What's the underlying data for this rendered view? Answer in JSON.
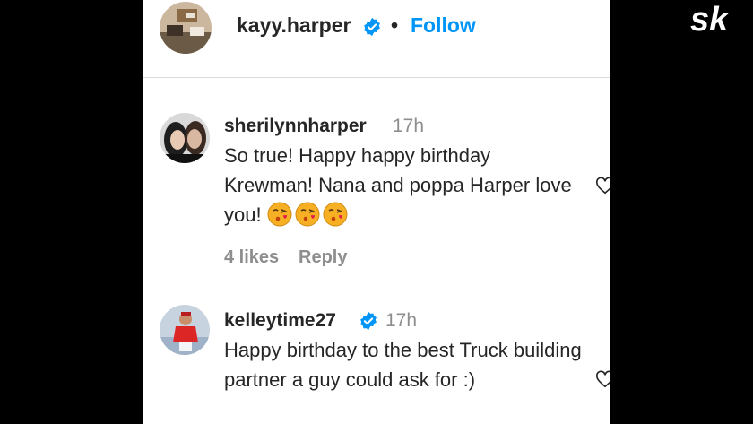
{
  "post_header": {
    "username": "kayy.harper",
    "separator": "•",
    "follow_label": "Follow"
  },
  "comments": [
    {
      "username": "sherilynnharper",
      "time": "17h",
      "text": "So true! Happy happy birthday Krewman! Nana and poppa Harper love you!",
      "emoji_count": 3,
      "likes": "4 likes",
      "reply_label": "Reply"
    },
    {
      "username": "kelleytime27",
      "verified": true,
      "time": "17h",
      "text": "Happy birthday to the best Truck building partner a guy could ask for :)"
    }
  ],
  "watermark": "sk",
  "colors": {
    "accent": "#0095f6",
    "text": "#262626",
    "muted": "#8e8e8e",
    "background": "#000000"
  },
  "icons": [
    "verified-badge-icon",
    "heart-icon",
    "kissing-heart-emoji-icon"
  ]
}
